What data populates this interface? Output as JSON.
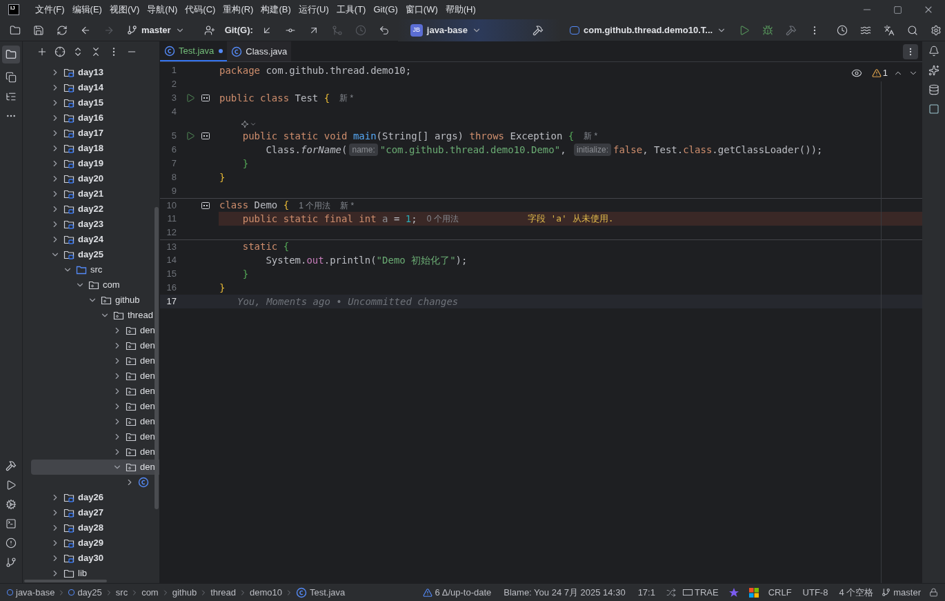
{
  "title_bar": {
    "logo": "IJ",
    "menu": [
      "文件(F)",
      "编辑(E)",
      "视图(V)",
      "导航(N)",
      "代码(C)",
      "重构(R)",
      "构建(B)",
      "运行(U)",
      "工具(T)",
      "Git(G)",
      "窗口(W)",
      "帮助(H)"
    ]
  },
  "toolbar": {
    "branch": "master",
    "git_label": "Git(G):",
    "project_badge": "JB",
    "project": "java-base",
    "run_config": "com.github.thread.demo10.T..."
  },
  "tree": [
    {
      "label": "day13",
      "kind": "module",
      "expanded": false,
      "selected": false
    },
    {
      "label": "day14",
      "kind": "module",
      "expanded": false,
      "selected": false
    },
    {
      "label": "day15",
      "kind": "module",
      "expanded": false,
      "selected": false
    },
    {
      "label": "day16",
      "kind": "module",
      "expanded": false,
      "selected": false
    },
    {
      "label": "day17",
      "kind": "module",
      "expanded": false,
      "selected": false
    },
    {
      "label": "day18",
      "kind": "module",
      "expanded": false,
      "selected": false
    },
    {
      "label": "day19",
      "kind": "module",
      "expanded": false,
      "selected": false
    },
    {
      "label": "day20",
      "kind": "module",
      "expanded": false,
      "selected": false
    },
    {
      "label": "day21",
      "kind": "module",
      "expanded": false,
      "selected": false
    },
    {
      "label": "day22",
      "kind": "module",
      "expanded": false,
      "selected": false
    },
    {
      "label": "day23",
      "kind": "module",
      "expanded": false,
      "selected": false
    },
    {
      "label": "day24",
      "kind": "module",
      "expanded": false,
      "selected": false
    },
    {
      "label": "day25",
      "kind": "module",
      "expanded": true,
      "selected": false,
      "children": [
        {
          "label": "src",
          "kind": "source",
          "expanded": true,
          "selected": false,
          "children": [
            {
              "label": "com",
              "kind": "package",
              "expanded": true,
              "selected": false,
              "children": [
                {
                  "label": "github",
                  "kind": "package",
                  "expanded": true,
                  "selected": false,
                  "children": [
                    {
                      "label": "thread",
                      "kind": "package",
                      "expanded": true,
                      "selected": false,
                      "children": [
                        {
                          "label": "den",
                          "kind": "package",
                          "expanded": false,
                          "selected": false
                        },
                        {
                          "label": "den",
                          "kind": "package",
                          "expanded": false,
                          "selected": false
                        },
                        {
                          "label": "den",
                          "kind": "package",
                          "expanded": false,
                          "selected": false
                        },
                        {
                          "label": "den",
                          "kind": "package",
                          "expanded": false,
                          "selected": false
                        },
                        {
                          "label": "den",
                          "kind": "package",
                          "expanded": false,
                          "selected": false
                        },
                        {
                          "label": "den",
                          "kind": "package",
                          "expanded": false,
                          "selected": false
                        },
                        {
                          "label": "den",
                          "kind": "package",
                          "expanded": false,
                          "selected": false
                        },
                        {
                          "label": "den",
                          "kind": "package",
                          "expanded": false,
                          "selected": false
                        },
                        {
                          "label": "den",
                          "kind": "package",
                          "expanded": false,
                          "selected": false
                        },
                        {
                          "label": "den",
                          "kind": "package",
                          "expanded": true,
                          "selected": true,
                          "children": [
                            {
                              "kind": "class",
                              "expanded": false,
                              "selected": false
                            }
                          ]
                        }
                      ]
                    }
                  ]
                }
              ]
            }
          ]
        }
      ]
    },
    {
      "label": "day26",
      "kind": "module",
      "expanded": false,
      "selected": false
    },
    {
      "label": "day27",
      "kind": "module",
      "expanded": false,
      "selected": false
    },
    {
      "label": "day28",
      "kind": "module",
      "expanded": false,
      "selected": false
    },
    {
      "label": "day29",
      "kind": "module",
      "expanded": false,
      "selected": false
    },
    {
      "label": "day30",
      "kind": "module",
      "expanded": false,
      "selected": false
    },
    {
      "label": "lib",
      "kind": "folder",
      "expanded": false,
      "selected": false
    }
  ],
  "tabs": [
    {
      "label": "Test.java",
      "selected": true,
      "modified": true
    },
    {
      "label": "Class.java",
      "selected": false,
      "modified": false
    }
  ],
  "inspections": {
    "warnings": "1"
  },
  "code": [
    {
      "kind": "line",
      "number": "1",
      "run": false,
      "marker": false,
      "separator_above": false,
      "warning": false,
      "current": false,
      "tokens": [
        {
          "kind": "kw",
          "text": "package"
        },
        {
          "kind": "plain",
          "text": " com.github.thread.demo10;"
        }
      ]
    },
    {
      "kind": "line",
      "number": "2",
      "run": false,
      "marker": false,
      "separator_above": false,
      "warning": false,
      "current": false
    },
    {
      "kind": "line",
      "number": "3",
      "run": true,
      "marker": true,
      "separator_above": false,
      "warning": false,
      "current": false,
      "tokens": [
        {
          "kind": "kw",
          "text": "public class "
        },
        {
          "kind": "plain",
          "text": "Test "
        },
        {
          "kind": "brace1",
          "text": "{"
        },
        {
          "kind": "meta",
          "text": "新 *"
        }
      ]
    },
    {
      "kind": "line",
      "number": "4",
      "run": false,
      "marker": false,
      "separator_above": false,
      "warning": false,
      "current": false
    },
    {
      "kind": "icon_row"
    },
    {
      "kind": "line",
      "number": "5",
      "run": true,
      "marker": true,
      "separator_above": false,
      "warning": false,
      "current": false,
      "tokens": [
        {
          "kind": "kw",
          "text": "    public static void "
        },
        {
          "kind": "fn",
          "text": "main"
        },
        {
          "kind": "plain",
          "text": "(String[] args) "
        },
        {
          "kind": "kw",
          "text": "throws "
        },
        {
          "kind": "plain",
          "text": "Exception "
        },
        {
          "kind": "brace2",
          "text": "{"
        },
        {
          "kind": "meta",
          "text": "新 *"
        }
      ]
    },
    {
      "kind": "line",
      "number": "6",
      "run": false,
      "marker": false,
      "separator_above": false,
      "warning": false,
      "current": false,
      "tokens": [
        {
          "kind": "plain",
          "text": "        Class."
        },
        {
          "kind": "italic",
          "text": "forName"
        },
        {
          "kind": "plain",
          "text": "("
        },
        {
          "kind": "hint",
          "text": "name:"
        },
        {
          "kind": "str",
          "text": "\"com.github.thread.demo10.Demo\""
        },
        {
          "kind": "plain",
          "text": ", "
        },
        {
          "kind": "hint",
          "text": "initialize:"
        },
        {
          "kind": "kw",
          "text": "false"
        },
        {
          "kind": "plain",
          "text": ", Test."
        },
        {
          "kind": "kw",
          "text": "class"
        },
        {
          "kind": "plain",
          "text": ".getClassLoader());"
        }
      ]
    },
    {
      "kind": "line",
      "number": "7",
      "run": false,
      "marker": false,
      "separator_above": false,
      "warning": false,
      "current": false,
      "tokens": [
        {
          "kind": "brace2",
          "text": "    }"
        }
      ]
    },
    {
      "kind": "line",
      "number": "8",
      "run": false,
      "marker": false,
      "separator_above": false,
      "warning": false,
      "current": false,
      "tokens": [
        {
          "kind": "brace1",
          "text": "}"
        }
      ]
    },
    {
      "kind": "line",
      "number": "9",
      "run": false,
      "marker": false,
      "separator_above": false,
      "warning": false,
      "current": false
    },
    {
      "kind": "line",
      "number": "10",
      "run": false,
      "marker": true,
      "separator_above": true,
      "warning": false,
      "current": false,
      "tokens": [
        {
          "kind": "kw",
          "text": "class "
        },
        {
          "kind": "plain",
          "text": "Demo "
        },
        {
          "kind": "brace1",
          "text": "{"
        },
        {
          "kind": "meta",
          "text": "1 个用法"
        },
        {
          "kind": "meta",
          "text": "新 *"
        }
      ]
    },
    {
      "kind": "line",
      "number": "11",
      "run": false,
      "marker": false,
      "separator_above": false,
      "warning": true,
      "current": false,
      "tokens": [
        {
          "kind": "kw",
          "text": "    public static final int "
        },
        {
          "kind": "unused",
          "text": "a"
        },
        {
          "kind": "plain",
          "text": " = "
        },
        {
          "kind": "num",
          "text": "1"
        },
        {
          "kind": "plain",
          "text": ";"
        },
        {
          "kind": "meta",
          "text": "0 个用法"
        },
        {
          "kind": "warn",
          "text": "字段 'a' 从未使用."
        }
      ]
    },
    {
      "kind": "line",
      "number": "12",
      "run": false,
      "marker": false,
      "separator_above": false,
      "warning": false,
      "current": false
    },
    {
      "kind": "line",
      "number": "13",
      "run": false,
      "marker": false,
      "separator_above": true,
      "warning": false,
      "current": false,
      "tokens": [
        {
          "kind": "kw",
          "text": "    static "
        },
        {
          "kind": "brace2",
          "text": "{"
        }
      ]
    },
    {
      "kind": "line",
      "number": "14",
      "run": false,
      "marker": false,
      "separator_above": false,
      "warning": false,
      "current": false,
      "tokens": [
        {
          "kind": "plain",
          "text": "        System."
        },
        {
          "kind": "field",
          "text": "out"
        },
        {
          "kind": "plain",
          "text": ".println("
        },
        {
          "kind": "str",
          "text": "\"Demo 初始化了\""
        },
        {
          "kind": "plain",
          "text": ");"
        }
      ]
    },
    {
      "kind": "line",
      "number": "15",
      "run": false,
      "marker": false,
      "separator_above": false,
      "warning": false,
      "current": false,
      "tokens": [
        {
          "kind": "brace2",
          "text": "    }"
        }
      ]
    },
    {
      "kind": "line",
      "number": "16",
      "run": false,
      "marker": false,
      "separator_above": false,
      "warning": false,
      "current": false,
      "tokens": [
        {
          "kind": "brace1",
          "text": "}"
        }
      ]
    },
    {
      "kind": "line",
      "number": "17",
      "run": false,
      "marker": false,
      "separator_above": false,
      "warning": false,
      "current": true,
      "tokens": [
        {
          "kind": "blame",
          "text": "You, Moments ago • Uncommitted changes"
        }
      ]
    }
  ],
  "status_bar": {
    "breadcrumbs": [
      {
        "label": "java-base",
        "kind": "module"
      },
      {
        "label": "day25",
        "kind": "module"
      },
      {
        "label": "src",
        "kind": "plain"
      },
      {
        "label": "com",
        "kind": "plain"
      },
      {
        "label": "github",
        "kind": "plain"
      },
      {
        "label": "thread",
        "kind": "plain"
      },
      {
        "label": "demo10",
        "kind": "plain"
      },
      {
        "label": "Test.java",
        "kind": "class"
      }
    ],
    "vcs": "6 Δ/up-to-date",
    "blame": "Blame: You 24 7月 2025 14:30",
    "position": "17:1",
    "trae": "TRAE",
    "line_separator": "CRLF",
    "encoding": "UTF-8",
    "indent": "4 个空格",
    "branch": "master"
  }
}
